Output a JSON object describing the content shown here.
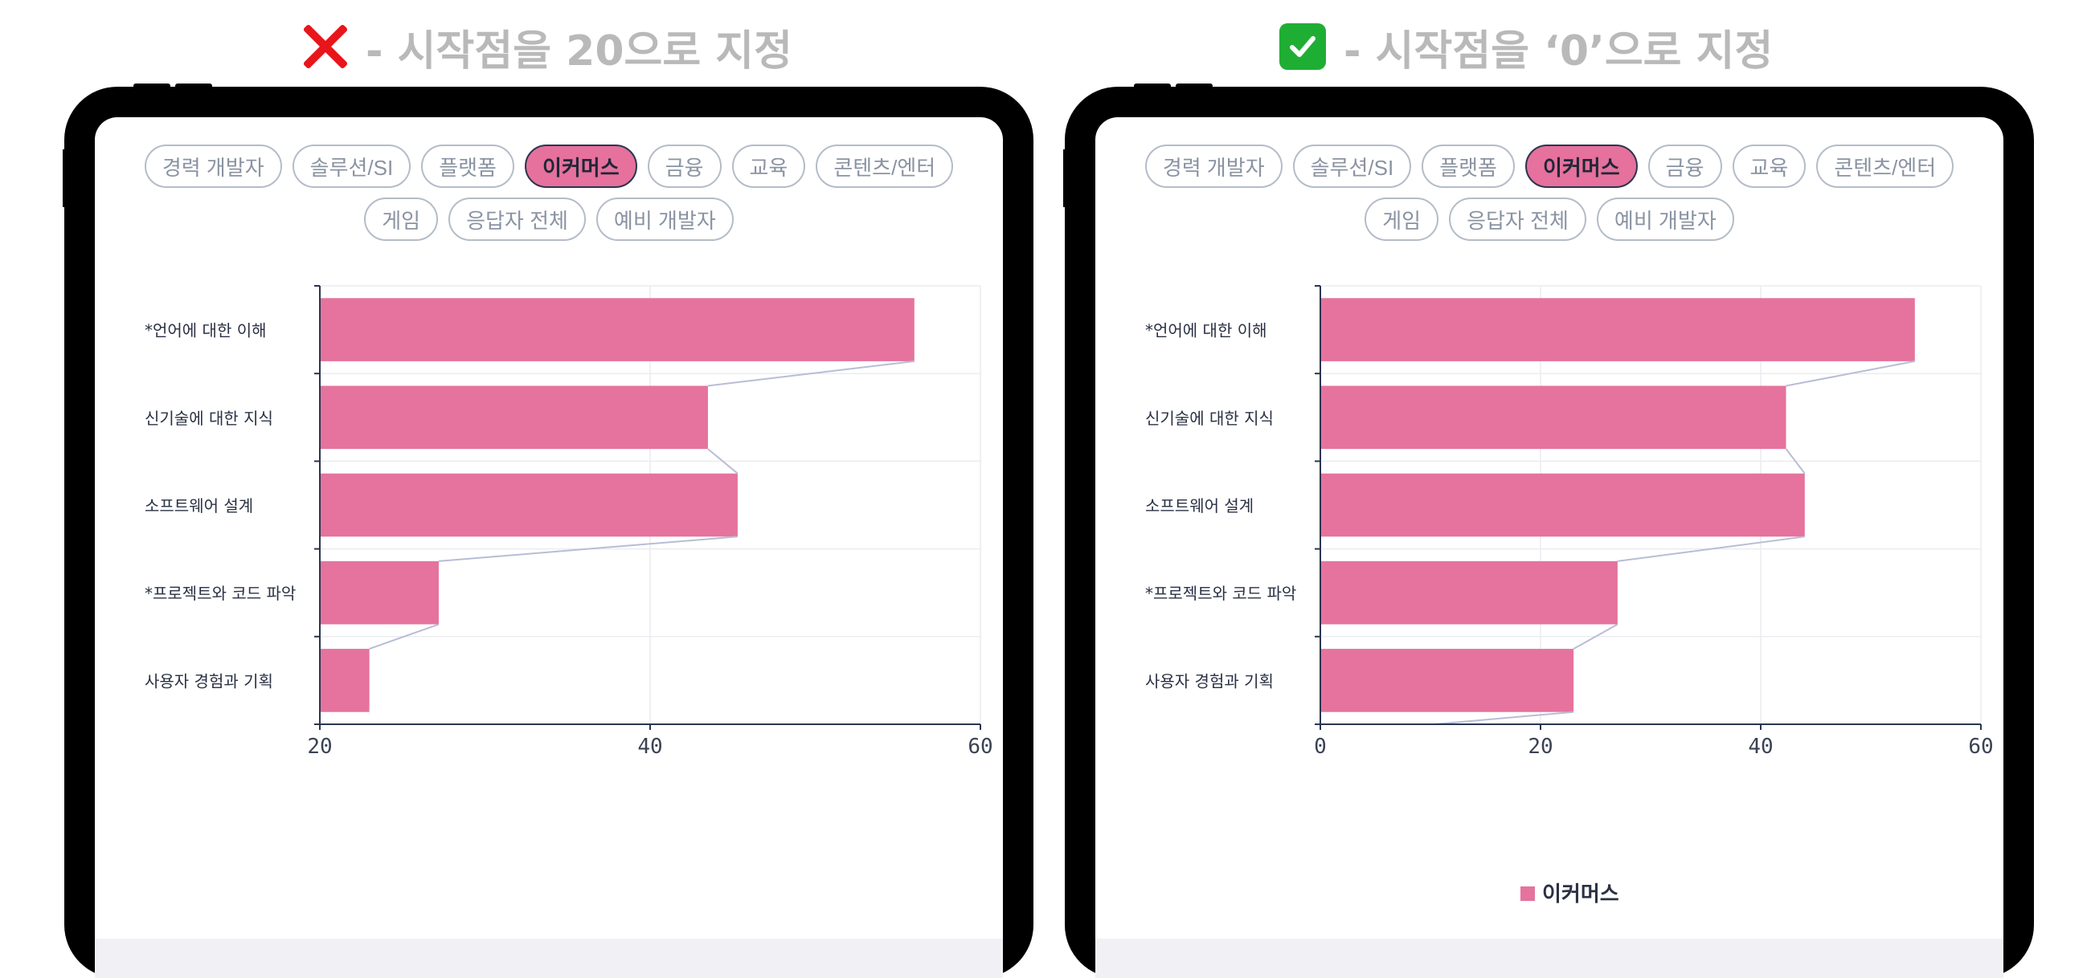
{
  "captions": {
    "left": {
      "icon": "cross-mark-icon",
      "text": "- 시작점을 20으로 지정"
    },
    "right": {
      "icon": "check-mark-icon",
      "text": "- 시작점을 ‘0’으로 지정"
    }
  },
  "filters": {
    "row1": [
      "경력 개발자",
      "솔루션/SI",
      "플랫폼",
      "이커머스",
      "금융",
      "교육",
      "콘텐츠/엔터"
    ],
    "row2": [
      "게임",
      "응답자 전체",
      "예비 개발자"
    ],
    "active": "이커머스"
  },
  "colors": {
    "bar": "#e5739d",
    "line": "#b8bdd6",
    "axis": "#2a3550",
    "grid": "#ececf1",
    "pill_border": "#b4bcc8",
    "pill_text": "#8a93a2",
    "caption": "#b9b9b9"
  },
  "chart_data": [
    {
      "type": "bar",
      "orientation": "horizontal",
      "categories": [
        "*언어에 대한 이해",
        "신기술에 대한 지식",
        "소프트웨어 설계",
        "*프로젝트와 코드 파악",
        "사용자 경험과 기획"
      ],
      "series": [
        {
          "values": [
            56,
            43.5,
            45.3,
            27.2,
            23
          ]
        }
      ],
      "xlim": [
        20,
        60
      ],
      "xticks": [
        "20",
        "40",
        "60"
      ],
      "grid": true,
      "legend": null
    },
    {
      "type": "bar",
      "orientation": "horizontal",
      "categories": [
        "*언어에 대한 이해",
        "신기술에 대한 지식",
        "소프트웨어 설계",
        "*프로젝트와 코드 파악",
        "사용자 경험과 기획"
      ],
      "series": [
        {
          "name": "이커머스",
          "values": [
            54,
            42.3,
            44,
            27,
            23
          ]
        }
      ],
      "xlim": [
        0,
        60
      ],
      "xticks": [
        "0",
        "20",
        "40",
        "60"
      ],
      "grid": true,
      "legend": "bottom-center"
    }
  ]
}
